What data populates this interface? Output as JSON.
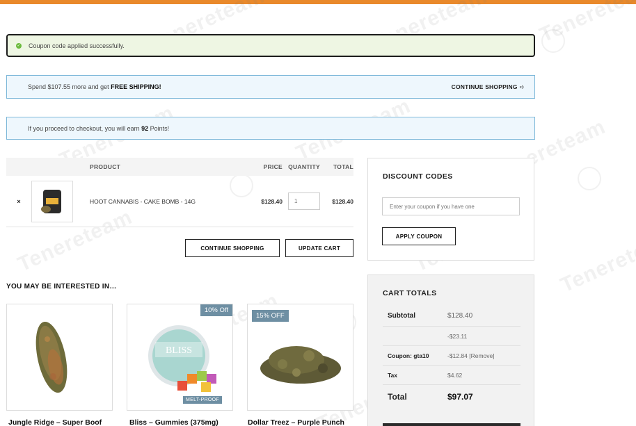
{
  "notices": {
    "success": "Coupon code applied successfully.",
    "shipping_prefix": "Spend $107.55 more and get ",
    "shipping_bold": "FREE SHIPPING!",
    "continue_link": "CONTINUE SHOPPING",
    "points_prefix": "If you proceed to checkout, you will earn ",
    "points_value": "92",
    "points_suffix": " Points!"
  },
  "cart": {
    "headers": {
      "product": "PRODUCT",
      "price": "PRICE",
      "quantity": "QUANTITY",
      "total": "TOTAL"
    },
    "items": [
      {
        "remove": "×",
        "name": "HOOT CANNABIS - CAKE BOMB - 14G",
        "price": "$128.40",
        "quantity": "1",
        "total": "$128.40"
      }
    ],
    "continue_button": "CONTINUE SHOPPING",
    "update_button": "UPDATE CART"
  },
  "interested": {
    "title": "YOU MAY BE INTERESTED IN…",
    "products": [
      {
        "name": "Jungle Ridge – Super Boof"
      },
      {
        "name": "Bliss – Gummies (375mg)",
        "badge": "10% Off",
        "sub_badge": "MELT-PROOF"
      },
      {
        "name": "Dollar Treez – Purple Punch",
        "badge": "15% OFF"
      }
    ]
  },
  "discount": {
    "title": "DISCOUNT CODES",
    "placeholder": "Enter your coupon if you have one",
    "apply_button": "APPLY COUPON"
  },
  "totals": {
    "title": "CART TOTALS",
    "subtotal_label": "Subtotal",
    "subtotal_value": "$128.40",
    "discount_value": "-$23.11",
    "coupon_label": "Coupon: gta10",
    "coupon_value": "-$12.84",
    "coupon_remove": "[Remove]",
    "tax_label": "Tax",
    "tax_value": "$4.62",
    "total_label": "Total",
    "total_value": "$97.07"
  },
  "watermark": "Tenereteam",
  "colors": {
    "accent": "#e9892b",
    "badge": "#6e8fa3",
    "info_border": "#7db8d9",
    "success_bg": "#eef6e3"
  }
}
